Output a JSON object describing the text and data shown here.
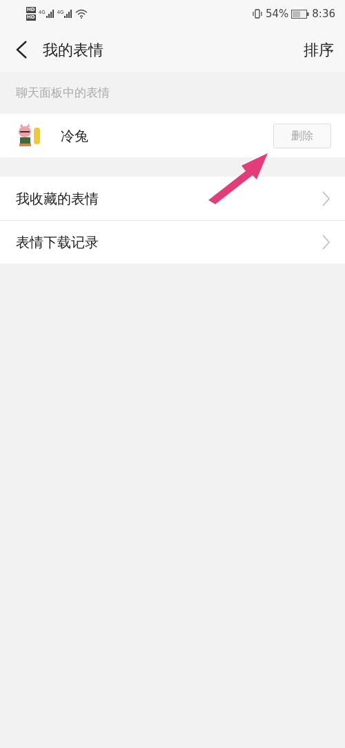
{
  "status_bar": {
    "sims": [
      {
        "hd": "HD",
        "net": "4G"
      },
      {
        "hd": "HD",
        "net": "4G"
      }
    ],
    "battery": "54%",
    "time": "8:36"
  },
  "header": {
    "title": "我的表情",
    "action": "排序"
  },
  "section_label": "聊天面板中的表情",
  "stickers": [
    {
      "name": "冷兔",
      "button": "删除"
    }
  ],
  "menu": [
    {
      "label": "我收藏的表情"
    },
    {
      "label": "表情下载记录"
    }
  ]
}
